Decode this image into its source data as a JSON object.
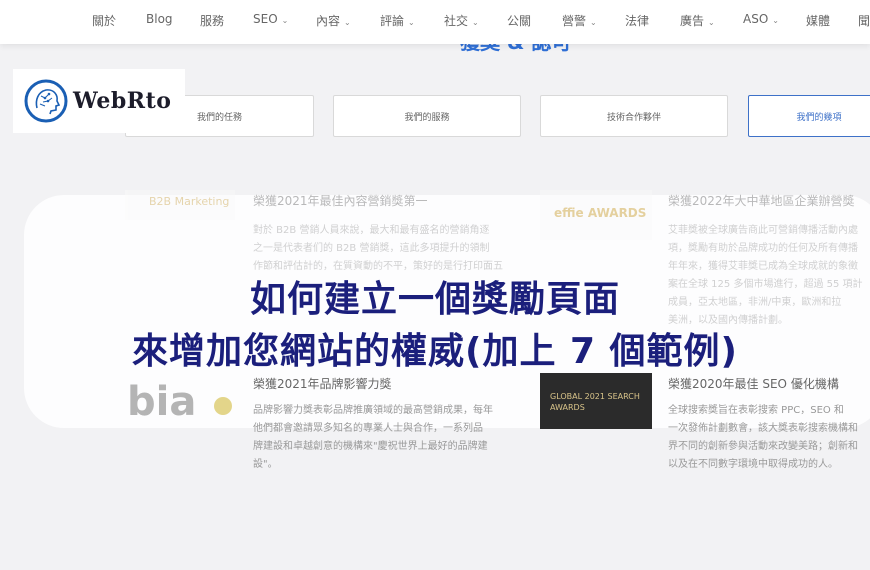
{
  "nav": {
    "items": [
      {
        "label": "關於",
        "dropdown": false
      },
      {
        "label": "Blog",
        "dropdown": false
      },
      {
        "label": "服務",
        "dropdown": false
      },
      {
        "label": "SEO",
        "dropdown": true
      },
      {
        "label": "內容",
        "dropdown": true
      },
      {
        "label": "評論",
        "dropdown": true
      },
      {
        "label": "社交",
        "dropdown": true
      },
      {
        "label": "公關",
        "dropdown": false
      },
      {
        "label": "營警",
        "dropdown": true
      },
      {
        "label": "法律",
        "dropdown": false
      },
      {
        "label": "廣告",
        "dropdown": true
      },
      {
        "label": "ASO",
        "dropdown": true
      },
      {
        "label": "媒體",
        "dropdown": false
      },
      {
        "label": "聞",
        "dropdown": false
      }
    ],
    "caret": "⌄"
  },
  "logo": {
    "text": "WebRto",
    "icon": "brain-head-icon"
  },
  "tabs": [
    "我們的任務",
    "我們的服務",
    "技術合作夥伴",
    "我們的幾項"
  ],
  "awards": [
    {
      "logo": "B2B Marketing",
      "title": "榮獲2021年最佳內容營銷獎第一",
      "text": [
        "對於 B2B 營銷人員來說，最大和最有盛名的營銷角逐",
        "之一是代表者们的 B2B 營銷獎，這此多項提升的領制",
        "作節和評估計的，在質資動的不平，策好的是行打印面五"
      ]
    },
    {
      "logo": "effie AWARDS",
      "title": "榮獲2022年大中華地區企業辦營獎",
      "text": [
        "艾菲獎被全球廣告商此可營銷傳播活動內處",
        "項，獎勵有助於品牌成功的任何及所有傳播",
        "年年來，獲得艾菲獎已成為全球成就的象徵",
        "案在全球 125 多個市場進行，超過 55 項計",
        "成員，亞太地區，非洲/中東，歐洲和拉",
        "美洲，以及國內傳播計劃。"
      ]
    },
    {
      "logo": "bia",
      "title": "榮獲2021年品牌影響力獎",
      "text": [
        "品牌影響力獎表彰品牌推廣領域的最高營銷成果，每年",
        "他們都會邀請眾多知名的專業人士與合作，一系列品",
        "牌建設和卓越創意的機構來\"慶祝世界上最好的品牌建",
        "設\"。"
      ]
    },
    {
      "logo": "GLOBAL 2021 SEARCH AWARDS",
      "title": "榮獲2020年最佳 SEO 優化機構",
      "text": [
        "全球搜索獎旨在表彰搜索 PPC，SEO 和",
        "一次發佈計劃數會，該大獎表彰搜索機構和",
        "界不同的創新參與活動來改變美路；創新和",
        "以及在不同數字環境中取得成功的人。"
      ]
    }
  ],
  "headline": {
    "line1": "如何建立一個獎勵頁面",
    "line2": "來增加您網站的權威(加上 7 個範例)"
  },
  "colors": {
    "accent": "#3e71c8",
    "headline": "#1b1f7c",
    "nav_text": "#666666"
  }
}
